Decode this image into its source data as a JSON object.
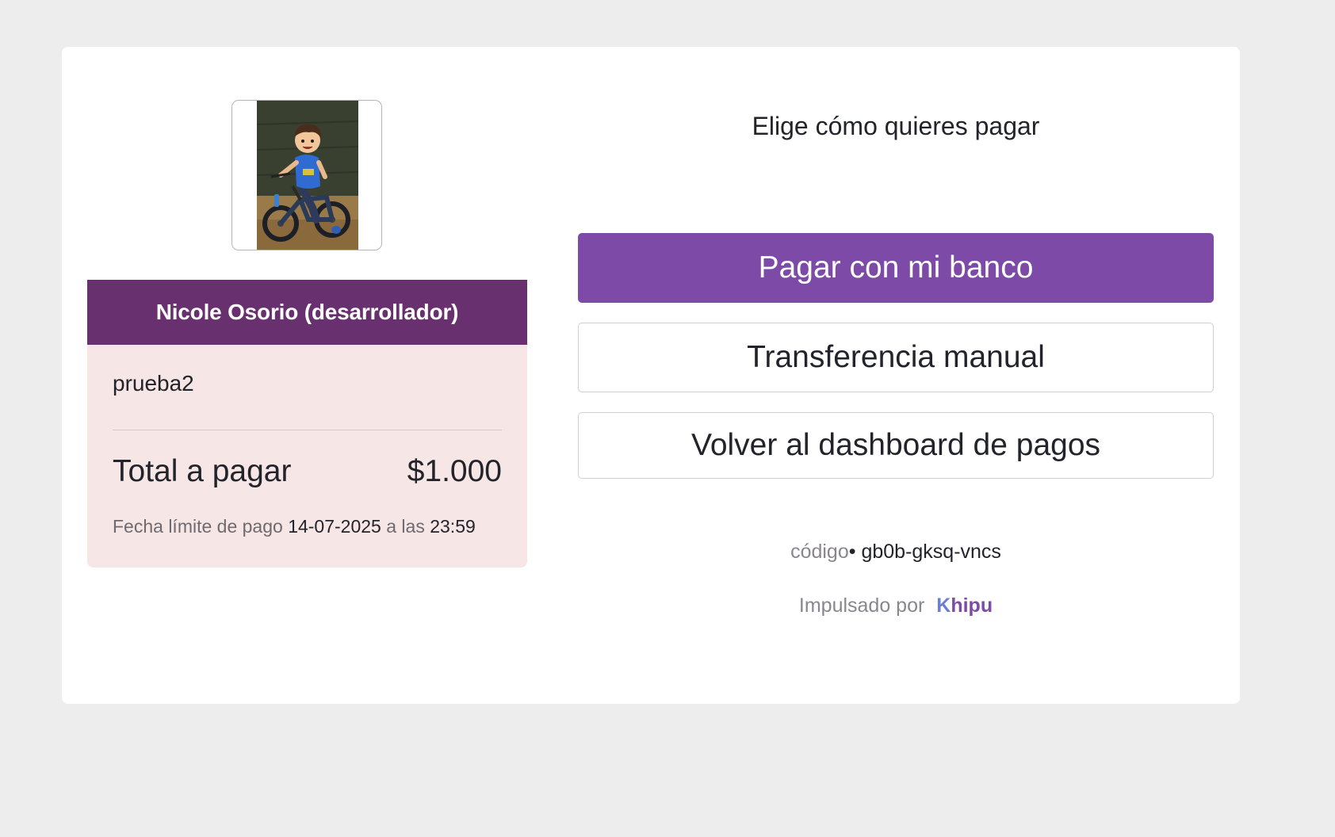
{
  "merchant": {
    "name": "Nicole Osorio (desarrollador)",
    "photo_alt": "merchant-avatar"
  },
  "payment": {
    "subject": "prueba2",
    "total_label": "Total a pagar",
    "total_amount": "$1.000",
    "deadline_label": "Fecha límite de pago",
    "deadline_date": "14-07-2025",
    "deadline_connector": "a las",
    "deadline_time": "23:59"
  },
  "options": {
    "title": "Elige cómo quieres pagar",
    "pay_bank_label": "Pagar con mi banco",
    "manual_transfer_label": "Transferencia manual",
    "back_dashboard_label": "Volver al dashboard de pagos"
  },
  "footer": {
    "code_label": "código",
    "code_separator": "•",
    "code_value": "gb0b-gksq-vncs",
    "powered_label": "Impulsado por",
    "brand_first": "K",
    "brand_rest": "hipu"
  },
  "colors": {
    "page_background": "#ededed",
    "card_background": "#ffffff",
    "merchant_banner": "#68306e",
    "summary_background": "#f6e6e5",
    "primary_button": "#7d4aa7",
    "brand": "#7d4aa7"
  }
}
